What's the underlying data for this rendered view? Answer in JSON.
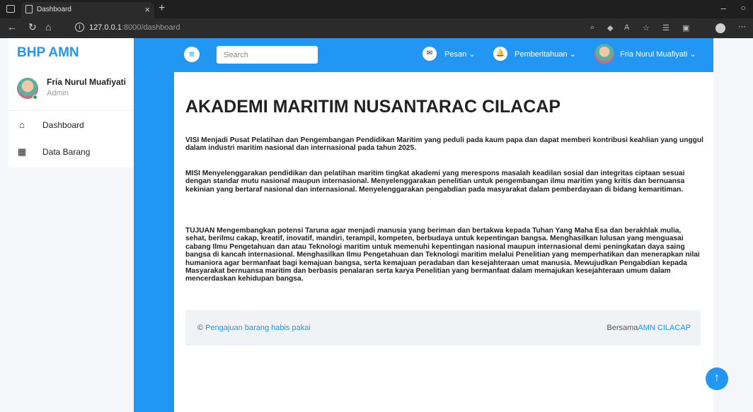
{
  "browser": {
    "tab_title": "Dashboard",
    "tab_close": "×",
    "new_tab": "+",
    "url_host": "127.0.0.1",
    "url_path": ":8000/dashboard",
    "min": "–",
    "close": "ⓘ"
  },
  "sidebar": {
    "brand": "BHP AMN",
    "user_name": "Fria Nurul Muafiyati",
    "user_role": "Admin",
    "items": [
      {
        "label": "Dashboard",
        "icon": "home-icon",
        "glyph": "⌂"
      },
      {
        "label": "Data Barang",
        "icon": "grid-icon",
        "glyph": "▦"
      }
    ]
  },
  "topbar": {
    "menu_glyph": "≡",
    "search_placeholder": "Search",
    "messages_label": "Pesan ⌄",
    "notifications_label": "Pemberitahuan ⌄",
    "user_label": "Fria Nurul Muafiyati ⌄",
    "messages_glyph": "✉",
    "notifications_glyph": "🔔"
  },
  "main": {
    "title": "AKADEMI MARITIM NUSANTARAC CILACAP",
    "visi": "VISI Menjadi Pusat Pelatihan dan Pengembangan Pendidikan Maritim yang peduli pada kaum papa dan dapat memberi kontribusi keahlian yang unggul dalam industri maritim nasional dan internasional pada tahun 2025.",
    "misi": "MISI Menyelenggarakan pendidikan dan pelatihan maritim tingkat akademi yang merespons masalah keadilan sosial dan integritas ciptaan sesuai dengan standar mutu nasional maupun internasional. Menyelenggarakan penelitian untuk pengembangan ilmu maritim yang kritis dan bernuansa kekinian yang bertaraf nasional dan internasional. Menyelenggarakan pengabdian pada masyarakat dalam pemberdayaan di bidang kemaritiman.",
    "tujuan": "TUJUAN Mengembangkan potensi Taruna agar menjadi manusia yang beriman dan bertakwa kepada Tuhan Yang Maha Esa dan berakhlak mulia, sehat, berilmu cakap, kreatif, inovatif, mandiri, terampil, kompeten, berbudaya untuk kepentingan bangsa. Menghasilkan lulusan yang menguasai cabang Ilmu Pengetahuan dan atau Teknologi maritim untuk memenuhi kepentingan nasional maupun internasional demi peningkatan daya saing bangsa di kancah internasional. Menghasilkan Ilmu Pengetahuan dan Teknologi maritim melalui Penelitian yang memperhatikan dan menerapkan nilai humaniora agar bermanfaat bagi kemajuan bangsa, serta kemajuan peradaban dan kesejahteraan umat manusia. Mewujudkan Pengabdian kepada Masyarakat bernuansa maritim dan berbasis penalaran serta karya Penelitian yang bermanfaat dalam memajukan kesejahteraan umum dalam mencerdaskan kehidupan bangsa."
  },
  "footer": {
    "copyright_symbol": "©",
    "copyright_link": "Pengajuan barang habis pakai",
    "credit_prefix": "Bersama",
    "credit_link": "AMN CILACAP"
  },
  "scroll_top_glyph": "↑",
  "colors": {
    "accent": "#2196f3",
    "chrome_dark": "#1f1f1f"
  }
}
